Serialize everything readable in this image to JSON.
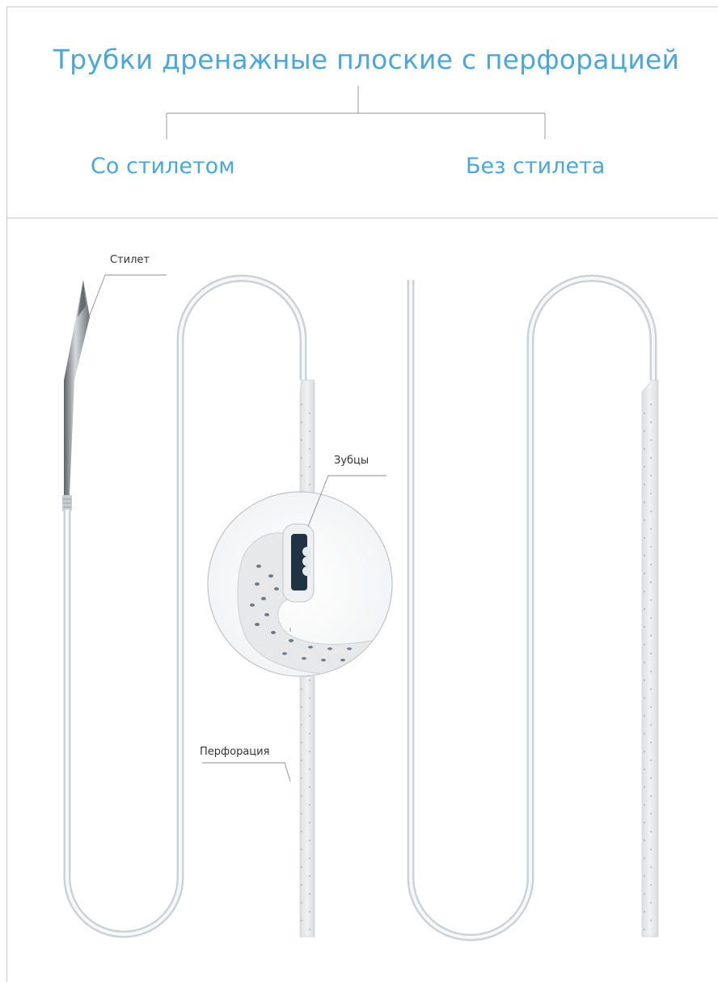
{
  "header": {
    "title": "Трубки дренажные плоские с перфорацией",
    "branches": [
      "Со стилетом",
      "Без стилета"
    ]
  },
  "callouts": {
    "stylet": "Стилет",
    "teeth": "Зубцы",
    "perforation": "Перфорация"
  },
  "colors": {
    "accent": "#4aa6dd",
    "lines": "#a9a9a9",
    "tube": "#e2e4e6",
    "needle": "#8a8f95"
  }
}
